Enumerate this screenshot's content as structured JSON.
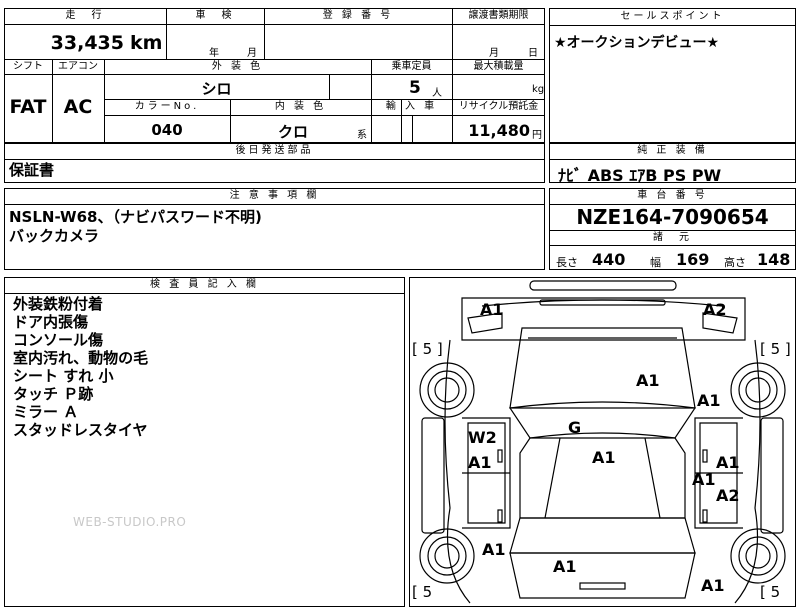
{
  "header": {
    "mileage_label": "走　行",
    "shaken_label": "車　検",
    "reg_label": "登 録 番 号",
    "transfer_label": "譲渡書類期限",
    "sale_label": "セールスポイント",
    "mileage_value": "33,435",
    "mileage_unit": "km",
    "shaken_year": "年",
    "shaken_month": "月",
    "transfer_month": "月",
    "transfer_day": "日",
    "sale_point": "★オークションデビュー★"
  },
  "spec": {
    "shift_label": "シフト",
    "ac_label": "エアコン",
    "exterior_label": "外 装 色",
    "capacity_label": "乗車定員",
    "max_load_label": "最大積載量",
    "shift": "FAT",
    "ac": "AC",
    "exterior_color": "シロ",
    "capacity": "5",
    "capacity_unit": "人",
    "max_load_unit": "kg",
    "color_no_label": "カラーNo.",
    "interior_label": "内 装 色",
    "import_label": "輸 入 車",
    "recycle_label": "リサイクル預託金",
    "color_no": "040",
    "interior_color": "クロ",
    "interior_suffix": "系",
    "recycle_amount": "11,480",
    "recycle_unit": "円"
  },
  "later": {
    "label": "後日発送部品",
    "value": "保証書"
  },
  "equipment": {
    "label": "純 正 装 備",
    "value": "ﾅﾋﾞ ABS ｴｱB PS PW"
  },
  "notes": {
    "label": "注 意 事 項 欄",
    "lines": [
      "NSLN-W68、（ナビパスワード不明)",
      "バックカメラ"
    ]
  },
  "chassis": {
    "label": "車 台 番 号",
    "value": "NZE164-7090654"
  },
  "dims": {
    "label": "諸　元",
    "length_label": "長さ",
    "length": "440",
    "width_label": "幅",
    "width": "169",
    "height_label": "高さ",
    "height": "148"
  },
  "inspector": {
    "label": "検 査 員 記 入 欄",
    "lines": [
      "外装鉄粉付着",
      "ドア内張傷",
      "コンソール傷",
      "室内汚れ、動物の毛",
      "シート すれ 小",
      "タッチ Ｐ跡",
      "ミラー Ａ",
      "スタッドレスタイヤ"
    ]
  },
  "watermark": "WEB-STUDIO.PRO",
  "diagram": {
    "tire_tl": "[ 5 ]",
    "tire_tr": "[ 5 ]",
    "tire_bl": "[ 5",
    "tire_br": "[ 5",
    "marks": {
      "front_left": "A1",
      "front_right": "A2",
      "hood": "A1",
      "fender_r": "A1",
      "roof": "G",
      "door_fl": "W2",
      "door_fl2": "A1",
      "cabin": "A1",
      "door_fr1": "A1",
      "door_fr2": "A1",
      "door_rr": "A2",
      "quarter_l": "A1",
      "trunk": "A1",
      "rear_r": "A1"
    }
  }
}
